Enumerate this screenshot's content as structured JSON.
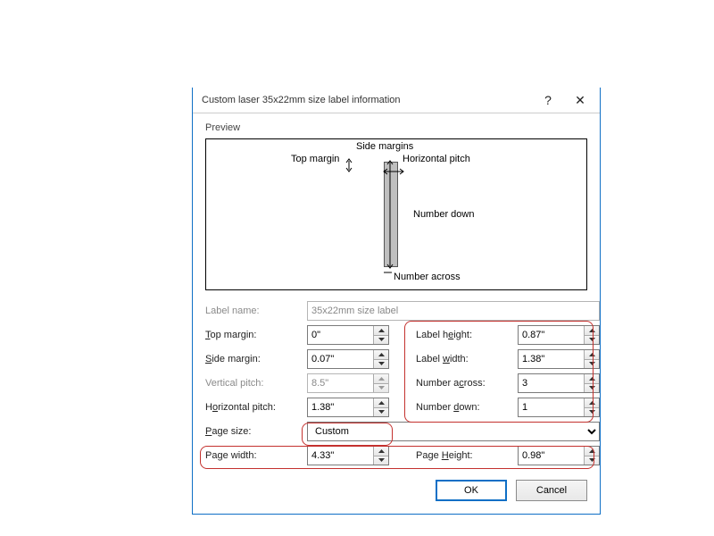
{
  "titlebar": {
    "title": "Custom laser 35x22mm size label information",
    "help": "?",
    "close": "✕"
  },
  "preview": {
    "group": "Preview",
    "side_margins": "Side margins",
    "top_margin": "Top margin",
    "horizontal_pitch": "Horizontal pitch",
    "number_down": "Number down",
    "number_across": "Number across"
  },
  "labels": {
    "label_name": "Label name:",
    "top_margin": "Top margin:",
    "side_margin": "Side margin:",
    "vertical_pitch": "Vertical pitch:",
    "horizontal_pitch": "Horizontal pitch:",
    "page_size": "Page size:",
    "page_width": "Page width:",
    "label_height": "Label height:",
    "label_width": "Label width:",
    "number_across": "Number across:",
    "number_down": "Number down:",
    "page_height": "Page Height:"
  },
  "values": {
    "label_name": "35x22mm size label",
    "top_margin": "0\"",
    "side_margin": "0.07\"",
    "vertical_pitch": "8.5\"",
    "horizontal_pitch": "1.38\"",
    "page_size": "Custom",
    "page_width": "4.33\"",
    "label_height": "0.87\"",
    "label_width": "1.38\"",
    "number_across": "3",
    "number_down": "1",
    "page_height": "0.98\""
  },
  "buttons": {
    "ok": "OK",
    "cancel": "Cancel"
  }
}
